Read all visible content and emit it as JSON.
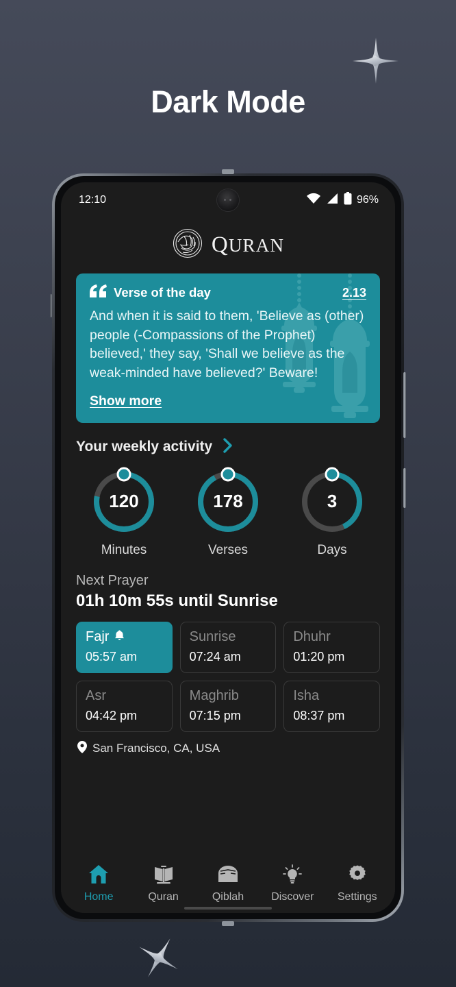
{
  "page": {
    "headline": "Dark Mode",
    "accent_color": "#1d8d9b",
    "background_top": "#454a59",
    "background_bottom": "#242a35"
  },
  "status_bar": {
    "time": "12:10",
    "battery_percent": "96%",
    "icons": [
      "wifi-icon",
      "cellular-signal-icon",
      "battery-icon"
    ]
  },
  "app_header": {
    "brand_first_letter": "Q",
    "brand_rest": "URAN",
    "logo": "quran-calligraphy-logo"
  },
  "verse_card": {
    "title": "Verse of the day",
    "quote_icon": "quote-icon",
    "reference": "2.13",
    "text": "And when it is said to them, 'Believe as (other) people (-Compassions of the Prophet) believed,' they say, 'Shall we believe as the weak-minded have believed?' Beware!",
    "show_more": "Show more"
  },
  "activity": {
    "title": "Your weekly activity",
    "chevron": "chevron-right-icon",
    "rings": [
      {
        "value": "120",
        "label": "Minutes",
        "percent": 78
      },
      {
        "value": "178",
        "label": "Verses",
        "percent": 92
      },
      {
        "value": "3",
        "label": "Days",
        "percent": 43
      }
    ]
  },
  "next_prayer": {
    "label": "Next Prayer",
    "countdown": "01h 10m 55s until Sunrise",
    "prayers": [
      {
        "name": "Fajr",
        "time": "05:57 am",
        "active": true,
        "alarm": "bell-icon"
      },
      {
        "name": "Sunrise",
        "time": "07:24 am",
        "active": false,
        "alarm": ""
      },
      {
        "name": "Dhuhr",
        "time": "01:20 pm",
        "active": false,
        "alarm": ""
      },
      {
        "name": "Asr",
        "time": "04:42 pm",
        "active": false,
        "alarm": ""
      },
      {
        "name": "Maghrib",
        "time": "07:15 pm",
        "active": false,
        "alarm": ""
      },
      {
        "name": "Isha",
        "time": "08:37 pm",
        "active": false,
        "alarm": ""
      }
    ],
    "location": "San Francisco, CA, USA",
    "location_icon": "map-pin-icon"
  },
  "bottom_nav": {
    "items": [
      {
        "label": "Home",
        "icon": "home-icon",
        "active": true
      },
      {
        "label": "Quran",
        "icon": "book-icon",
        "active": false
      },
      {
        "label": "Qiblah",
        "icon": "kaaba-icon",
        "active": false
      },
      {
        "label": "Discover",
        "icon": "lightbulb-icon",
        "active": false
      },
      {
        "label": "Settings",
        "icon": "gear-icon",
        "active": false
      }
    ]
  }
}
